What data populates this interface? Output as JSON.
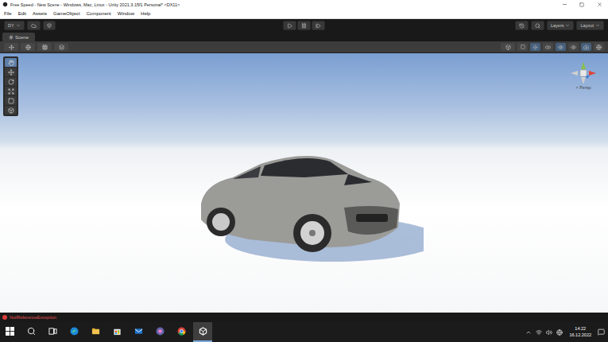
{
  "window": {
    "title": "Free Speed - New Scene - Windows, Mac, Linux - Unity 2021.3.15f1 Personal* <DX11>"
  },
  "menu": [
    "File",
    "Edit",
    "Assets",
    "GameObject",
    "Component",
    "Window",
    "Help"
  ],
  "toolbar": {
    "account": "DY",
    "layers": "Layers",
    "layout": "Layout",
    "playing": false,
    "paused": false
  },
  "scene_tab": {
    "label": "Scene",
    "selected": true
  },
  "tools": [
    {
      "kind": "hand",
      "selected": true
    },
    {
      "kind": "move",
      "selected": false
    },
    {
      "kind": "rotate",
      "selected": false
    },
    {
      "kind": "scale",
      "selected": false
    },
    {
      "kind": "rect",
      "selected": false
    },
    {
      "kind": "transform",
      "selected": false
    }
  ],
  "gizmo": {
    "label": "< Persp"
  },
  "status": {
    "message": "NullReferenceException",
    "error": true
  },
  "taskbar": {
    "apps": [
      {
        "kind": "search",
        "selected": false
      },
      {
        "kind": "taskview",
        "selected": false
      },
      {
        "kind": "edge",
        "selected": false
      },
      {
        "kind": "explorer",
        "selected": false
      },
      {
        "kind": "store",
        "selected": false
      },
      {
        "kind": "mail",
        "selected": false
      },
      {
        "kind": "teams",
        "selected": false
      },
      {
        "kind": "chrome",
        "selected": false
      },
      {
        "kind": "unity",
        "selected": true
      }
    ],
    "time": "14:22",
    "date": "16.12.2022"
  }
}
